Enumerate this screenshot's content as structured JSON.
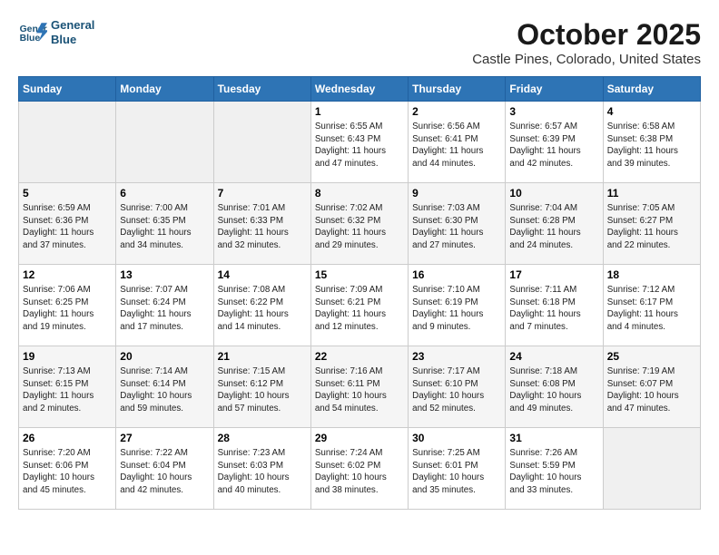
{
  "header": {
    "logo_line1": "General",
    "logo_line2": "Blue",
    "month": "October 2025",
    "location": "Castle Pines, Colorado, United States"
  },
  "weekdays": [
    "Sunday",
    "Monday",
    "Tuesday",
    "Wednesday",
    "Thursday",
    "Friday",
    "Saturday"
  ],
  "weeks": [
    [
      {
        "day": "",
        "info": ""
      },
      {
        "day": "",
        "info": ""
      },
      {
        "day": "",
        "info": ""
      },
      {
        "day": "1",
        "info": "Sunrise: 6:55 AM\nSunset: 6:43 PM\nDaylight: 11 hours\nand 47 minutes."
      },
      {
        "day": "2",
        "info": "Sunrise: 6:56 AM\nSunset: 6:41 PM\nDaylight: 11 hours\nand 44 minutes."
      },
      {
        "day": "3",
        "info": "Sunrise: 6:57 AM\nSunset: 6:39 PM\nDaylight: 11 hours\nand 42 minutes."
      },
      {
        "day": "4",
        "info": "Sunrise: 6:58 AM\nSunset: 6:38 PM\nDaylight: 11 hours\nand 39 minutes."
      }
    ],
    [
      {
        "day": "5",
        "info": "Sunrise: 6:59 AM\nSunset: 6:36 PM\nDaylight: 11 hours\nand 37 minutes."
      },
      {
        "day": "6",
        "info": "Sunrise: 7:00 AM\nSunset: 6:35 PM\nDaylight: 11 hours\nand 34 minutes."
      },
      {
        "day": "7",
        "info": "Sunrise: 7:01 AM\nSunset: 6:33 PM\nDaylight: 11 hours\nand 32 minutes."
      },
      {
        "day": "8",
        "info": "Sunrise: 7:02 AM\nSunset: 6:32 PM\nDaylight: 11 hours\nand 29 minutes."
      },
      {
        "day": "9",
        "info": "Sunrise: 7:03 AM\nSunset: 6:30 PM\nDaylight: 11 hours\nand 27 minutes."
      },
      {
        "day": "10",
        "info": "Sunrise: 7:04 AM\nSunset: 6:28 PM\nDaylight: 11 hours\nand 24 minutes."
      },
      {
        "day": "11",
        "info": "Sunrise: 7:05 AM\nSunset: 6:27 PM\nDaylight: 11 hours\nand 22 minutes."
      }
    ],
    [
      {
        "day": "12",
        "info": "Sunrise: 7:06 AM\nSunset: 6:25 PM\nDaylight: 11 hours\nand 19 minutes."
      },
      {
        "day": "13",
        "info": "Sunrise: 7:07 AM\nSunset: 6:24 PM\nDaylight: 11 hours\nand 17 minutes."
      },
      {
        "day": "14",
        "info": "Sunrise: 7:08 AM\nSunset: 6:22 PM\nDaylight: 11 hours\nand 14 minutes."
      },
      {
        "day": "15",
        "info": "Sunrise: 7:09 AM\nSunset: 6:21 PM\nDaylight: 11 hours\nand 12 minutes."
      },
      {
        "day": "16",
        "info": "Sunrise: 7:10 AM\nSunset: 6:19 PM\nDaylight: 11 hours\nand 9 minutes."
      },
      {
        "day": "17",
        "info": "Sunrise: 7:11 AM\nSunset: 6:18 PM\nDaylight: 11 hours\nand 7 minutes."
      },
      {
        "day": "18",
        "info": "Sunrise: 7:12 AM\nSunset: 6:17 PM\nDaylight: 11 hours\nand 4 minutes."
      }
    ],
    [
      {
        "day": "19",
        "info": "Sunrise: 7:13 AM\nSunset: 6:15 PM\nDaylight: 11 hours\nand 2 minutes."
      },
      {
        "day": "20",
        "info": "Sunrise: 7:14 AM\nSunset: 6:14 PM\nDaylight: 10 hours\nand 59 minutes."
      },
      {
        "day": "21",
        "info": "Sunrise: 7:15 AM\nSunset: 6:12 PM\nDaylight: 10 hours\nand 57 minutes."
      },
      {
        "day": "22",
        "info": "Sunrise: 7:16 AM\nSunset: 6:11 PM\nDaylight: 10 hours\nand 54 minutes."
      },
      {
        "day": "23",
        "info": "Sunrise: 7:17 AM\nSunset: 6:10 PM\nDaylight: 10 hours\nand 52 minutes."
      },
      {
        "day": "24",
        "info": "Sunrise: 7:18 AM\nSunset: 6:08 PM\nDaylight: 10 hours\nand 49 minutes."
      },
      {
        "day": "25",
        "info": "Sunrise: 7:19 AM\nSunset: 6:07 PM\nDaylight: 10 hours\nand 47 minutes."
      }
    ],
    [
      {
        "day": "26",
        "info": "Sunrise: 7:20 AM\nSunset: 6:06 PM\nDaylight: 10 hours\nand 45 minutes."
      },
      {
        "day": "27",
        "info": "Sunrise: 7:22 AM\nSunset: 6:04 PM\nDaylight: 10 hours\nand 42 minutes."
      },
      {
        "day": "28",
        "info": "Sunrise: 7:23 AM\nSunset: 6:03 PM\nDaylight: 10 hours\nand 40 minutes."
      },
      {
        "day": "29",
        "info": "Sunrise: 7:24 AM\nSunset: 6:02 PM\nDaylight: 10 hours\nand 38 minutes."
      },
      {
        "day": "30",
        "info": "Sunrise: 7:25 AM\nSunset: 6:01 PM\nDaylight: 10 hours\nand 35 minutes."
      },
      {
        "day": "31",
        "info": "Sunrise: 7:26 AM\nSunset: 5:59 PM\nDaylight: 10 hours\nand 33 minutes."
      },
      {
        "day": "",
        "info": ""
      }
    ]
  ]
}
